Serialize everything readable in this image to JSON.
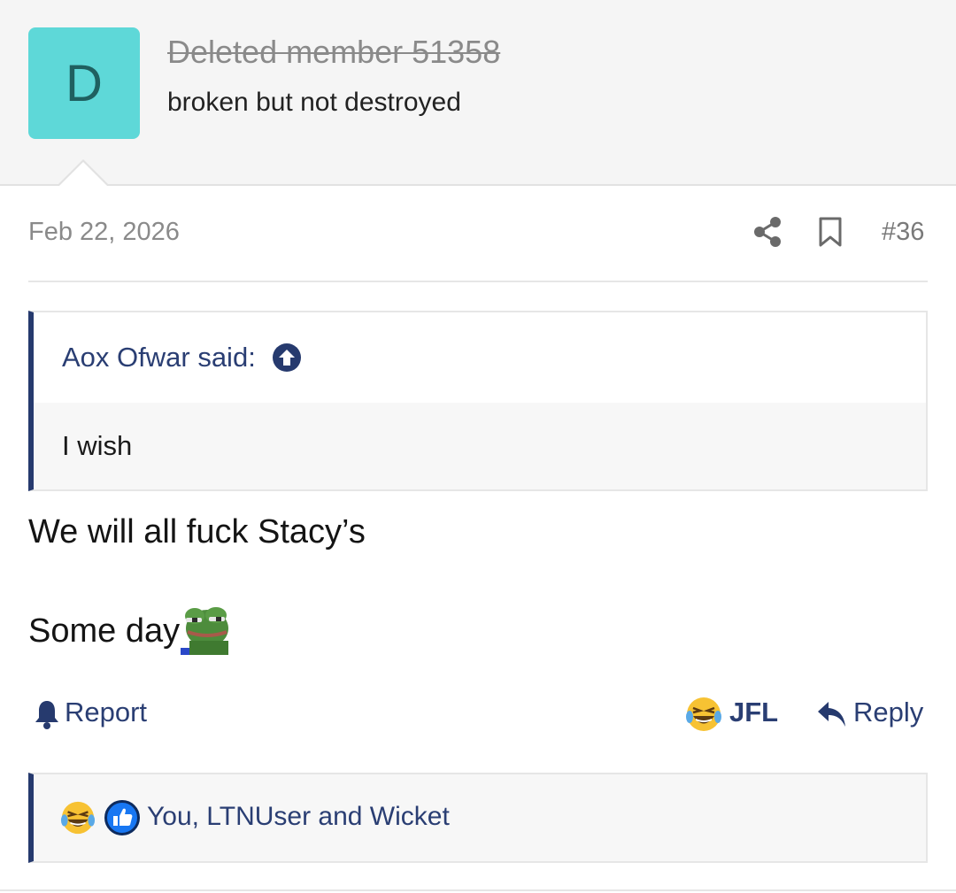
{
  "post": {
    "avatar_letter": "D",
    "username": "Deleted member 51358",
    "user_title": "broken but not destroyed",
    "date": "Feb 22, 2026",
    "post_number": "#36"
  },
  "quote": {
    "author": "Aox Ofwar said:",
    "text": "I wish"
  },
  "message": {
    "line1": "We will all fuck Stacy’s",
    "line2": "Some day"
  },
  "actions": {
    "report": "Report",
    "reaction": "JFL",
    "reply": "Reply"
  },
  "reactions": {
    "summary": "You, LTNUser and Wicket"
  },
  "icons": {
    "share": "share-icon",
    "bookmark": "bookmark-icon",
    "quote_jump": "arrow-up-circle-icon",
    "report": "bell-icon",
    "jfl": "laughing-crying-emoji-icon",
    "reply": "reply-arrow-icon",
    "like": "thumbs-up-icon"
  },
  "colors": {
    "avatar_bg": "#5ed8d8",
    "accent": "#263a6e",
    "link": "#2a3e73",
    "muted": "#8a8a8a"
  }
}
